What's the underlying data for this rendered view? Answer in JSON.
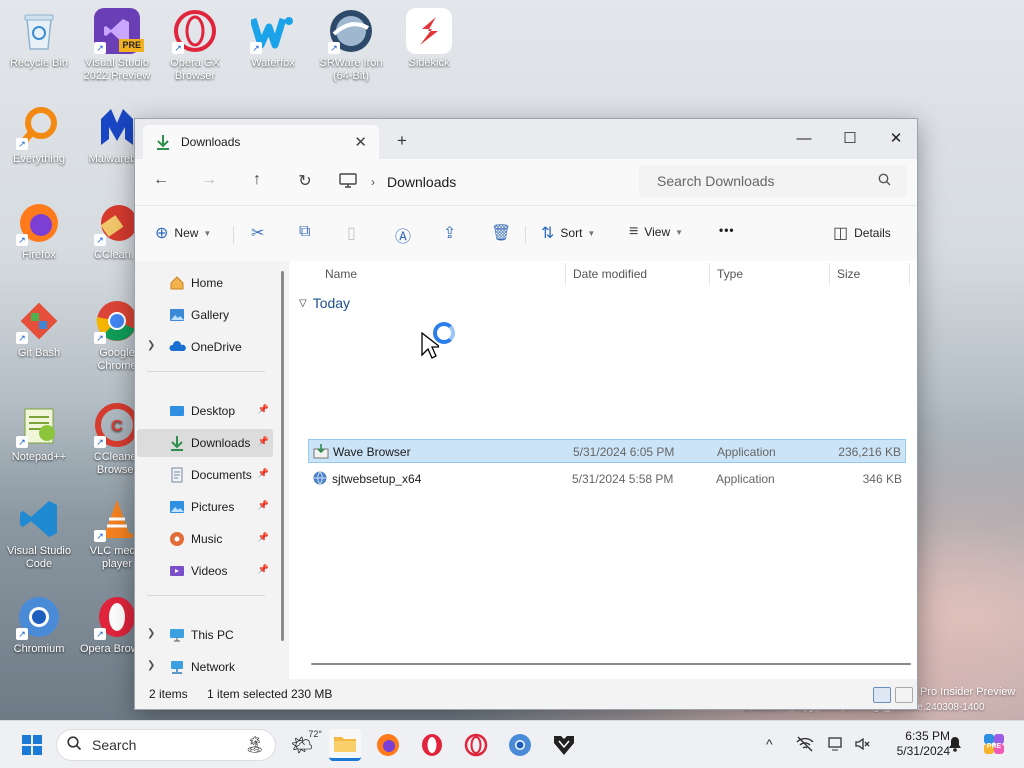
{
  "desktop": {
    "icons": [
      {
        "label": "Recycle Bin",
        "icon": "recycle-bin-icon"
      },
      {
        "label": "Visual Studio 2022 Preview",
        "icon": "visual-studio-icon",
        "badge": "PRE"
      },
      {
        "label": "Opera GX Browser",
        "icon": "opera-gx-icon"
      },
      {
        "label": "Waterfox",
        "icon": "waterfox-icon"
      },
      {
        "label": "SRWare Iron (64-Bit)",
        "icon": "srware-iron-icon"
      },
      {
        "label": "Sidekick",
        "icon": "sidekick-icon"
      },
      {
        "label": "Everything",
        "icon": "everything-icon"
      },
      {
        "label": "Malwareb...",
        "icon": "malwarebytes-icon"
      },
      {
        "label": "Firefox",
        "icon": "firefox-icon"
      },
      {
        "label": "CClean...",
        "icon": "ccleaner-icon"
      },
      {
        "label": "Git Bash",
        "icon": "git-bash-icon"
      },
      {
        "label": "Google Chrome",
        "icon": "chrome-icon"
      },
      {
        "label": "Notepad++",
        "icon": "notepad-plus-plus-icon"
      },
      {
        "label": "CCleaner Browser",
        "icon": "ccleaner-browser-icon"
      },
      {
        "label": "Visual Studio Code",
        "icon": "vscode-icon"
      },
      {
        "label": "VLC media player",
        "icon": "vlc-icon"
      },
      {
        "label": "Chromium",
        "icon": "chromium-icon"
      },
      {
        "label": "Opera Browser",
        "icon": "opera-icon"
      }
    ],
    "watermark_line1": "Pro Insider Preview",
    "watermark_line2": "Evaluation copy. Build 26xxx.ge_release.240308-1400"
  },
  "window": {
    "tab_title": "Downloads",
    "new_tab_glyph": "+",
    "controls": {
      "minimize": "—",
      "maximize": "☐",
      "close": "✕"
    },
    "address": {
      "path": "Downloads",
      "separator": "›"
    },
    "search_placeholder": "Search Downloads",
    "commands": {
      "new": "New",
      "sort": "Sort",
      "view": "View",
      "more": "•••",
      "details": "Details"
    },
    "sidebar": {
      "items": [
        {
          "label": "Home",
          "icon": "home-icon"
        },
        {
          "label": "Gallery",
          "icon": "gallery-icon"
        },
        {
          "label": "OneDrive",
          "icon": "onedrive-icon"
        },
        {
          "label": "Desktop",
          "icon": "desktop-folder-icon"
        },
        {
          "label": "Downloads",
          "icon": "downloads-folder-icon"
        },
        {
          "label": "Documents",
          "icon": "documents-folder-icon"
        },
        {
          "label": "Pictures",
          "icon": "pictures-folder-icon"
        },
        {
          "label": "Music",
          "icon": "music-folder-icon"
        },
        {
          "label": "Videos",
          "icon": "videos-folder-icon"
        },
        {
          "label": "This PC",
          "icon": "this-pc-icon"
        },
        {
          "label": "Network",
          "icon": "network-icon"
        }
      ]
    },
    "columns": [
      "Name",
      "Date modified",
      "Type",
      "Size"
    ],
    "group_label": "Today",
    "files": [
      {
        "name": "Wave Browser",
        "date": "5/31/2024 6:05 PM",
        "type": "Application",
        "size": "236,216 KB",
        "selected": true
      },
      {
        "name": "sjtwebsetup_x64",
        "date": "5/31/2024 5:58 PM",
        "type": "Application",
        "size": "346 KB",
        "selected": false
      }
    ],
    "status": {
      "count": "2 items",
      "selection": "1 item selected",
      "size": "230 MB"
    }
  },
  "taskbar": {
    "search_label": "Search",
    "weather_temp": "72°",
    "time": "6:35 PM",
    "date": "5/31/2024",
    "tray_chevron": "^"
  },
  "colors": {
    "accent": "#0067c0",
    "selection": "#cce4f7",
    "folder_blue": "#2a6ac3"
  }
}
